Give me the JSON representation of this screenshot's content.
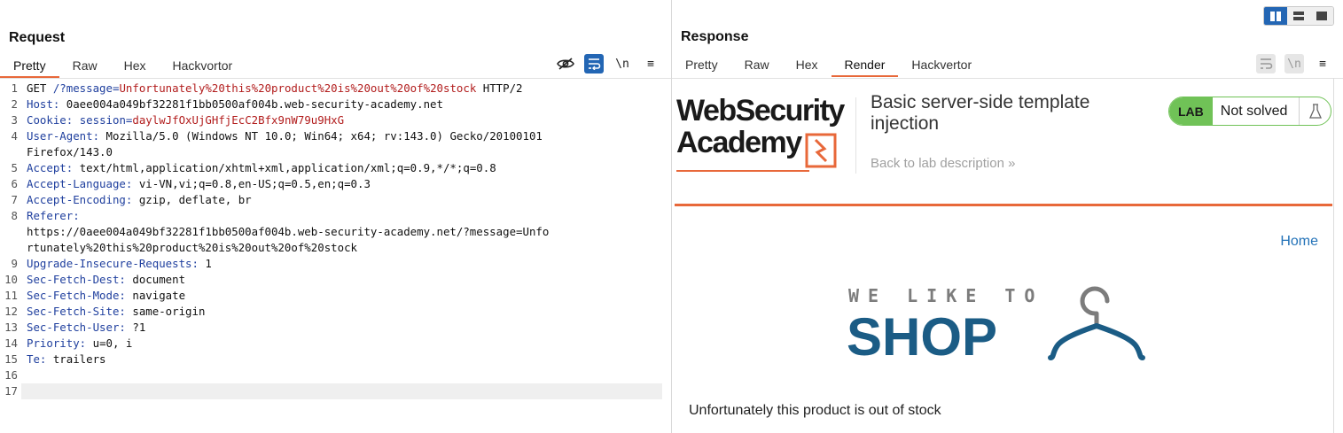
{
  "request": {
    "title": "Request",
    "tabs": [
      "Pretty",
      "Raw",
      "Hex",
      "Hackvortor"
    ],
    "active_tab": "Pretty",
    "icons": [
      "eye-slash-icon",
      "wrap-icon",
      "newline-icon",
      "menu-icon"
    ],
    "newline_label": "\\n",
    "menu_label": "≡",
    "line_numbers": [
      "1",
      "2",
      "3",
      "4",
      "",
      "5",
      "6",
      "7",
      "8",
      "",
      "",
      "9",
      "10",
      "11",
      "12",
      "13",
      "14",
      "15",
      "16",
      "17"
    ],
    "lines": [
      {
        "parts": [
          {
            "t": "GET ",
            "c": "plain"
          },
          {
            "t": "/?message=",
            "c": "blue"
          },
          {
            "t": "Unfortunately%20this%20product%20is%20out%20of%20stock",
            "c": "red"
          },
          {
            "t": " HTTP/2",
            "c": "plain"
          }
        ]
      },
      {
        "parts": [
          {
            "t": "Host: ",
            "c": "blue"
          },
          {
            "t": "0aee004a049bf32281f1bb0500af004b.web-security-academy.net",
            "c": "plain"
          }
        ]
      },
      {
        "parts": [
          {
            "t": "Cookie: ",
            "c": "blue"
          },
          {
            "t": "session=",
            "c": "blue"
          },
          {
            "t": "daylwJfOxUjGHfjEcC2Bfx9nW79u9HxG",
            "c": "red"
          }
        ]
      },
      {
        "parts": [
          {
            "t": "User-Agent: ",
            "c": "blue"
          },
          {
            "t": "Mozilla/5.0 (Windows NT 10.0; Win64; x64; rv:143.0) Gecko/20100101",
            "c": "plain"
          }
        ]
      },
      {
        "parts": [
          {
            "t": "Firefox/143.0",
            "c": "plain"
          }
        ]
      },
      {
        "parts": [
          {
            "t": "Accept: ",
            "c": "blue"
          },
          {
            "t": "text/html,application/xhtml+xml,application/xml;q=0.9,*/*;q=0.8",
            "c": "plain"
          }
        ]
      },
      {
        "parts": [
          {
            "t": "Accept-Language: ",
            "c": "blue"
          },
          {
            "t": "vi-VN,vi;q=0.8,en-US;q=0.5,en;q=0.3",
            "c": "plain"
          }
        ]
      },
      {
        "parts": [
          {
            "t": "Accept-Encoding: ",
            "c": "blue"
          },
          {
            "t": "gzip, deflate, br",
            "c": "plain"
          }
        ]
      },
      {
        "parts": [
          {
            "t": "Referer: ",
            "c": "blue"
          }
        ]
      },
      {
        "parts": [
          {
            "t": "https://0aee004a049bf32281f1bb0500af004b.web-security-academy.net/?message=Unfo",
            "c": "plain"
          }
        ]
      },
      {
        "parts": [
          {
            "t": "rtunately%20this%20product%20is%20out%20of%20stock",
            "c": "plain"
          }
        ]
      },
      {
        "parts": [
          {
            "t": "Upgrade-Insecure-Requests: ",
            "c": "blue"
          },
          {
            "t": "1",
            "c": "plain"
          }
        ]
      },
      {
        "parts": [
          {
            "t": "Sec-Fetch-Dest: ",
            "c": "blue"
          },
          {
            "t": "document",
            "c": "plain"
          }
        ]
      },
      {
        "parts": [
          {
            "t": "Sec-Fetch-Mode: ",
            "c": "blue"
          },
          {
            "t": "navigate",
            "c": "plain"
          }
        ]
      },
      {
        "parts": [
          {
            "t": "Sec-Fetch-Site: ",
            "c": "blue"
          },
          {
            "t": "same-origin",
            "c": "plain"
          }
        ]
      },
      {
        "parts": [
          {
            "t": "Sec-Fetch-User: ",
            "c": "blue"
          },
          {
            "t": "?1",
            "c": "plain"
          }
        ]
      },
      {
        "parts": [
          {
            "t": "Priority: ",
            "c": "blue"
          },
          {
            "t": "u=0, i",
            "c": "plain"
          }
        ]
      },
      {
        "parts": [
          {
            "t": "Te: ",
            "c": "blue"
          },
          {
            "t": "trailers",
            "c": "plain"
          }
        ]
      },
      {
        "parts": []
      },
      {
        "parts": []
      }
    ]
  },
  "response": {
    "title": "Response",
    "tabs": [
      "Pretty",
      "Raw",
      "Hex",
      "Render",
      "Hackvertor"
    ],
    "active_tab": "Render",
    "newline_label": "\\n",
    "menu_label": "≡",
    "render": {
      "logo_line1": "WebSecurity",
      "logo_line2": "Academy",
      "lab_title": "Basic server-side template injection",
      "back_link": "Back to lab description  »",
      "lab_badge": "LAB",
      "lab_status": "Not solved",
      "home_link": "Home",
      "shop_tagline": "WE LIKE TO",
      "shop_word": "SHOP",
      "message": "Unfortunately this product is out of stock"
    }
  },
  "colors": {
    "accent_orange": "#e8683a",
    "tool_blue": "#2366b4",
    "lab_green": "#70c257",
    "shop_blue": "#1b5c85"
  }
}
